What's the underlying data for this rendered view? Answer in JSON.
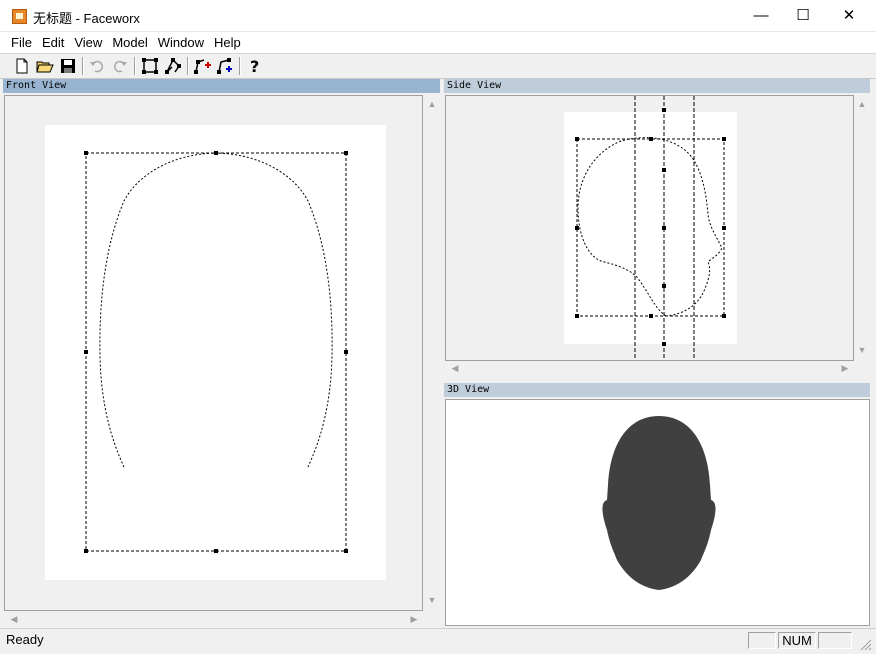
{
  "window": {
    "title": "无标题 - Faceworx",
    "controls": {
      "minimize": "—",
      "maximize": "☐",
      "close": "✕"
    }
  },
  "menu": [
    "File",
    "Edit",
    "View",
    "Model",
    "Window",
    "Help"
  ],
  "toolbar": {
    "buttons": [
      "new-icon",
      "open-icon",
      "save-icon",
      "undo-icon",
      "redo-icon",
      "select-rect-icon",
      "edit-contour-icon",
      "add-point-icon",
      "insert-point-icon",
      "help-icon"
    ]
  },
  "panes": {
    "front": {
      "title": "Front View"
    },
    "side": {
      "title": "Side View"
    },
    "three_d": {
      "title": "3D View"
    }
  },
  "status": {
    "text": "Ready",
    "num": "NUM"
  },
  "colors": {
    "title_active": "#99b4d1",
    "title_inactive": "#bfcddb",
    "head": "#404040"
  }
}
